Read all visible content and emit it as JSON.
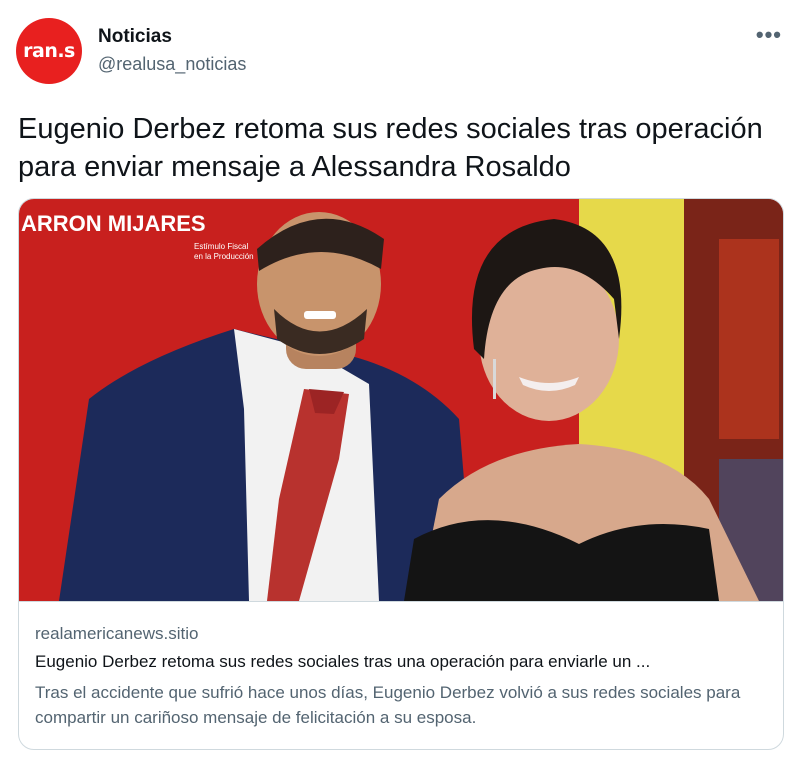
{
  "account": {
    "avatar_text": "ran.s",
    "name": "Noticias",
    "handle": "@realusa_noticias",
    "more_icon": "•••"
  },
  "tweet": {
    "text": "Eugenio Derbez retoma sus redes sociales tras operación para enviar mensaje a Alessandra Rosaldo"
  },
  "card": {
    "image_backdrop_text_1": "ARRON MIJARES",
    "image_backdrop_text_2": "Estímulo Fiscal",
    "image_backdrop_text_3": "en la Producción",
    "domain": "realamericanews.sitio",
    "title": "Eugenio Derbez retoma sus redes sociales tras una operación para enviarle un ...",
    "description": "Tras el accidente que sufrió hace unos días, Eugenio Derbez volvió a sus redes sociales para compartir un cariñoso mensaje de felicitación a su esposa."
  },
  "colors": {
    "brand_red": "#e8201f",
    "text_primary": "#0f1419",
    "text_secondary": "#536471",
    "border": "#cfd9de"
  }
}
